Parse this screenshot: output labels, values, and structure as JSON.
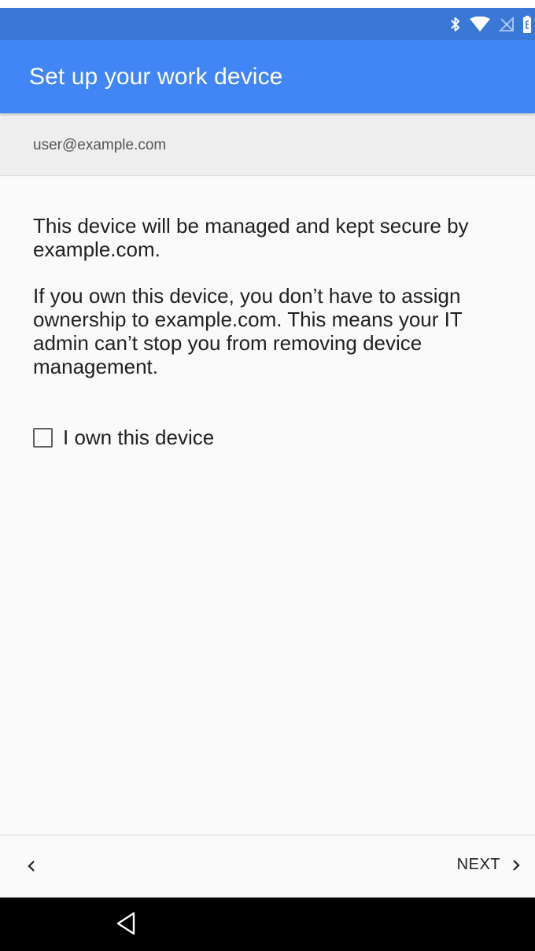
{
  "status_bar": {
    "icons": [
      "bluetooth-icon",
      "wifi-icon",
      "no-sim-icon",
      "battery-icon"
    ],
    "color": "#3a78d8"
  },
  "app_bar": {
    "title": "Set up your work device",
    "color": "#4285f4"
  },
  "account": {
    "email": "user@example.com"
  },
  "body": {
    "paragraph_1": "This device will be managed and kept secure by example.com.",
    "paragraph_2": "If you own this device, you don’t have to assign ownership to example.com. This means your IT admin can’t stop you from removing device management."
  },
  "ownership_checkbox": {
    "label": "I own this device",
    "checked": false
  },
  "footer": {
    "back_icon": "chevron-left-icon",
    "next_label": "NEXT",
    "next_icon": "chevron-right-icon"
  },
  "system_nav": {
    "back_icon": "triangle-back-icon"
  }
}
